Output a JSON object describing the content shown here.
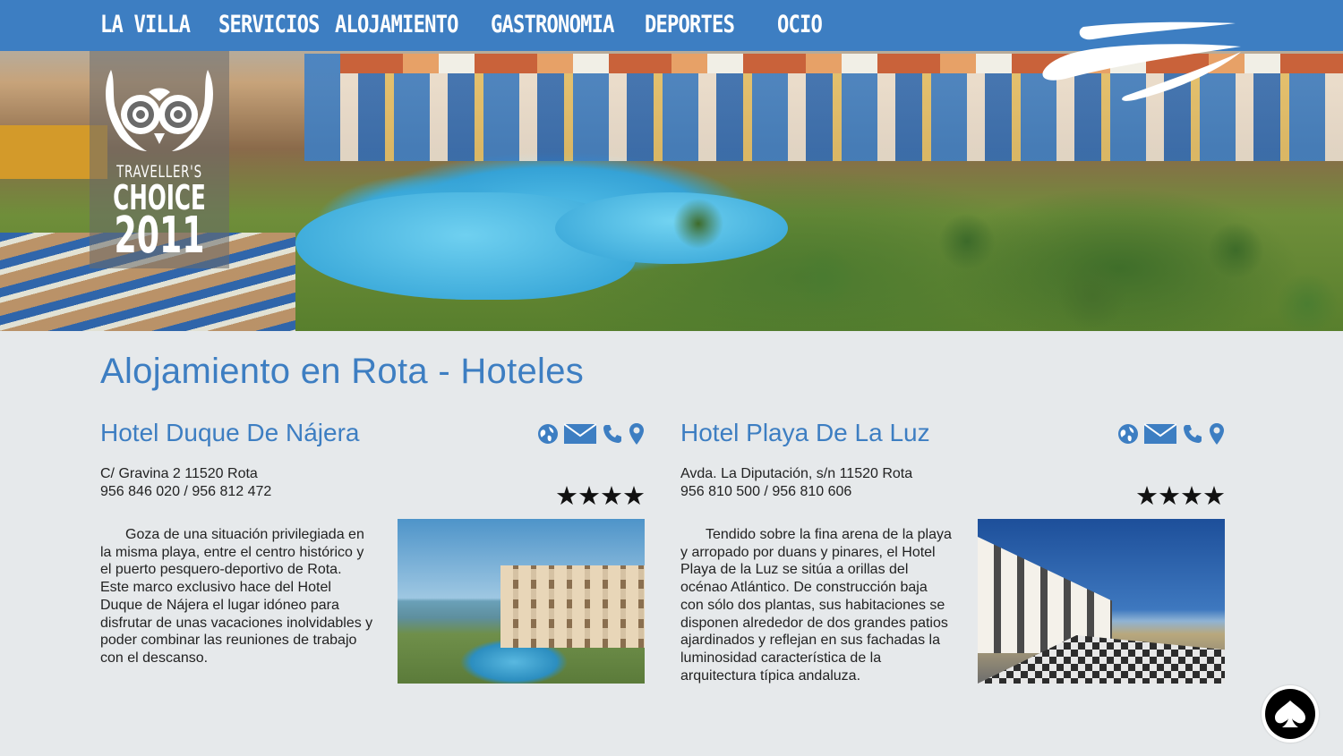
{
  "nav": {
    "items": [
      "LA VILLA",
      "SERVICIOS",
      "ALOJAMIENTO",
      "GASTRONOMIA",
      "DEPORTES",
      "OCIO"
    ]
  },
  "badge": {
    "line1": "TRAVELLER'S",
    "line2": "CHOICE",
    "year": "2011",
    "icon": "tripadvisor-owl-icon"
  },
  "page_title": "Alojamiento en Rota - Hoteles",
  "colors": {
    "nav_bg": "#3d7ec2",
    "accent": "#3d7ec2",
    "page_bg": "#e6e9eb",
    "text": "#222222"
  },
  "hotels": [
    {
      "name": "Hotel Duque De Nájera",
      "address": "C/ Gravina 2 11520 Rota",
      "phone": "956 846 020 / 956 812 472",
      "stars": "★★★★",
      "description": "Goza de una situación privilegiada en la misma playa, entre el centro histórico y el puerto pesquero-deportivo de Rota. Este marco exclusivo hace del Hotel Duque de Nájera el lugar idóneo para disfrutar de unas vacaciones inolvidables y poder combinar las reuniones de trabajo con el descanso.",
      "icons": [
        "globe-icon",
        "mail-icon",
        "phone-icon",
        "map-pin-icon"
      ]
    },
    {
      "name": "Hotel Playa De La Luz",
      "address": "Avda. La Diputación, s/n 11520 Rota",
      "phone": "956 810 500 / 956 810 606",
      "stars": "★★★★",
      "description": "Tendido sobre la fina arena de la playa y arropado por duans y pinares, el Hotel Playa de la Luz se sitúa a orillas del océnao Atlántico. De construcción baja con sólo dos plantas, sus habitaciones se disponen alrededor de dos grandes patios ajardinados y reflejan en sus fachadas la luminosidad característica de la arquitectura típica andaluza.",
      "icons": [
        "globe-icon",
        "mail-icon",
        "phone-icon",
        "map-pin-icon"
      ]
    }
  ],
  "fab": {
    "icon": "spade-icon"
  }
}
